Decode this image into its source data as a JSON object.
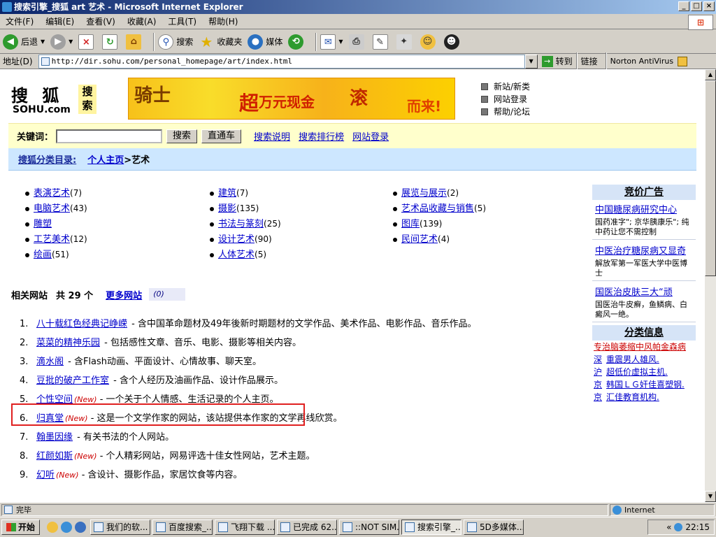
{
  "window": {
    "title": "搜索引擎_搜狐 art 艺术 - Microsoft Internet Explorer"
  },
  "menu": [
    "文件(F)",
    "编辑(E)",
    "查看(V)",
    "收藏(A)",
    "工具(T)",
    "帮助(H)"
  ],
  "toolbar": {
    "back": "后退",
    "search": "搜索",
    "favorites": "收藏夹",
    "media": "媒体"
  },
  "address": {
    "label": "地址(D)",
    "url": "http://dir.sohu.com/personal_homepage/art/index.html",
    "go": "转到",
    "links": "链接",
    "norton": "Norton AntiVirus"
  },
  "logo": {
    "big": "搜 狐",
    "sohu": "SOHU.com",
    "search": "搜索"
  },
  "banner": {
    "brand": "骑士",
    "t1": "超",
    "t2": "万元现金",
    "t3": "滚",
    "t4": "而来!"
  },
  "top_links": [
    "新站/新类",
    "网站登录",
    "帮助/论坛"
  ],
  "search": {
    "label": "关键词：",
    "button": "搜索",
    "button2": "直通车",
    "links": [
      "搜索说明",
      "搜索排行榜",
      "网站登录"
    ]
  },
  "breadcrumb": {
    "label": "搜狐分类目录:",
    "path": "个人主页",
    "current": ">艺术"
  },
  "categories": [
    [
      {
        "name": "表演艺术",
        "count": "(7)"
      },
      {
        "name": "电脑艺术",
        "count": "(43)"
      },
      {
        "name": "雕塑",
        "count": ""
      },
      {
        "name": "工艺美术",
        "count": "(12)"
      },
      {
        "name": "绘画",
        "count": "(51)"
      }
    ],
    [
      {
        "name": "建筑",
        "count": "(7)"
      },
      {
        "name": "摄影",
        "count": "(135)"
      },
      {
        "name": "书法与篆刻",
        "count": "(25)"
      },
      {
        "name": "设计艺术",
        "count": "(90)"
      },
      {
        "name": "人体艺术",
        "count": "(5)"
      }
    ],
    [
      {
        "name": "展览与展示",
        "count": "(2)"
      },
      {
        "name": "艺术品收藏与销售",
        "count": "(5)"
      },
      {
        "name": "图库",
        "count": "(139)"
      },
      {
        "name": "民间艺术",
        "count": "(4)"
      }
    ]
  ],
  "related": {
    "label": "相关网站",
    "count": "共 29 个",
    "more": "更多网站",
    "tag": "(0)"
  },
  "sites": [
    {
      "num": "1.",
      "title": "八十载红色经典记峥嵘",
      "new": "",
      "desc": " - 含中国革命题材及49年後新时期题材的文学作品、美术作品、电影作品、音乐作品。"
    },
    {
      "num": "2.",
      "title": "菜菜的精神乐园",
      "new": "",
      "desc": " - 包括感性文章、音乐、电影、摄影等相关内容。"
    },
    {
      "num": "3.",
      "title": "滴水阁",
      "new": "",
      "desc": " - 含Flash动画、平面设计、心情故事、聊天室。"
    },
    {
      "num": "4.",
      "title": "豆批的破产工作室",
      "new": "",
      "desc": " - 含个人经历及油画作品、设计作品展示。"
    },
    {
      "num": "5.",
      "title": "个性空间",
      "new": "(New)",
      "desc": " - 一个关于个人情感、生活记录的个人主页。"
    },
    {
      "num": "6.",
      "title": "归真堂",
      "new": "(New)",
      "desc": " - 这是一个文学作家的网站，该站提供本作家的文学再线欣赏。"
    },
    {
      "num": "7.",
      "title": "翰墨因缘",
      "new": "",
      "desc": " - 有关书法的个人网站。"
    },
    {
      "num": "8.",
      "title": "红颜如斯",
      "new": "(New)",
      "desc": " - 个人精彩网站，网易评选十佳女性网站，艺术主题。"
    },
    {
      "num": "9.",
      "title": "幻听",
      "new": "(New)",
      "desc": " - 含设计、摄影作品，家居饮食等内容。"
    }
  ],
  "side": {
    "ads_title": "竞价广告",
    "ads": [
      {
        "title": "中国糖尿病研究中心",
        "desc": "国药准字\"; 京华胰康乐\"; 纯中药让您不需控制"
      },
      {
        "title": "中医治疗糖尿病又显奇",
        "desc": "解放军第一军医大学中医博士"
      },
      {
        "title": "国医治皮肤三大“顽",
        "desc": "国医治牛皮癣，鱼鳞病、白癜风一绝。"
      }
    ],
    "class_title": "分类信息",
    "class_red": "专治脑萎缩中风帕金森病",
    "class_items": [
      {
        "pre": "深",
        "text": "重震男人雄风."
      },
      {
        "pre": "沪",
        "text": "超低价虚拟主机."
      },
      {
        "pre": "京",
        "text": "韩国ＬＧ奸佳喜塑钢."
      },
      {
        "pre": "京",
        "text": "汇佳教育机构."
      }
    ]
  },
  "status": {
    "text": "完毕",
    "zone": "Internet"
  },
  "taskbar": {
    "start": "开始",
    "tasks": [
      "我们的软...",
      "百度搜索_...",
      "飞翔下载 ...",
      "已完成 62...",
      "::NOT SIM...",
      "搜索引擎_...",
      "5D多媒体..."
    ],
    "clock": "22:15"
  }
}
